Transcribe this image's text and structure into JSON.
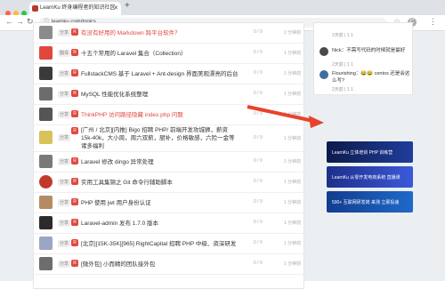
{
  "browser": {
    "tab_title": "LearnKu 终身编程者的知识社区",
    "url": "learnku.com/topics",
    "colors": {
      "close": "#ff5f57",
      "minimize": "#febc2e",
      "maximize": "#28c840"
    }
  },
  "topics": [
    {
      "category": "分享",
      "title": "有没有好用的 Markdown 跨平台软件？",
      "meta": "0 / 0",
      "time": "1 分钟前"
    },
    {
      "category": "翻译",
      "title": "十五个常用的 Laravel 集合（Collection）",
      "meta": "0 / 0",
      "time": "1 分钟前"
    },
    {
      "category": "分享",
      "title": "FullstackCMS 基于 Laravel + Ant-design 界面美观漂亮的后台",
      "meta": "0 / 0",
      "time": "1 分钟前"
    },
    {
      "category": "分享",
      "title": "MySQL 性能优化系统整理",
      "meta": "0 / 0",
      "time": "1 分钟前"
    },
    {
      "category": "分享",
      "title": "ThinkPHP 访问路径隐藏 index.php 问题",
      "meta": "0 / 0",
      "time": "1 分钟前"
    },
    {
      "category": "分享",
      "title": "[广州 / 北京][内推] Bigo 招聘 PHP/ 前端开发攻城狮，薪资 15k-40k，大小周，周六双薪，厨补，价格敏感，六险一金等诸多福利",
      "meta": "0 / 0",
      "time": "1 分钟前"
    },
    {
      "category": "分享",
      "title": "Laravel 修改 dingo 异常处理",
      "meta": "0 / 0",
      "time": "1 分钟前"
    },
    {
      "category": "分享",
      "title": "实用工具集锦之 Git 命令行辅助脚本",
      "meta": "0 / 0",
      "time": "1 分钟前"
    },
    {
      "category": "分享",
      "title": "PHP 使用 jwt 用户身份认证",
      "meta": "0 / 0",
      "time": "1 分钟前"
    },
    {
      "category": "分享",
      "title": "Laravel-admin 发布 1.7.0 版本",
      "meta": "0 / 0",
      "time": "1 分钟前"
    },
    {
      "category": "分享",
      "title": "[北京][15K-35K][965] RightCapital 招聘 PHP 中级、资深研发",
      "meta": "0 / 0",
      "time": "1 分钟前"
    },
    {
      "category": "分享",
      "title": "[微外包] 小而精的团队接外包",
      "meta": "0 / 0",
      "time": "1 分钟前"
    }
  ],
  "replies": [
    {
      "text": "",
      "meta": "2天前 | 1 1"
    },
    {
      "text": "Nick：不需写代码的时候就是最好",
      "meta": "2天前 | 1 1"
    },
    {
      "text": "Flourishing：😂😂 centos 还是会这么写?",
      "meta": "2天前 | 1 1"
    }
  ],
  "banners": [
    {
      "text": "LearnKu 立体培训 PHP 训练营"
    },
    {
      "text": "LearnKu 从零开发电商系统 直播课"
    },
    {
      "text": "500+ 互联网研发岗 来测 立即投递"
    }
  ]
}
